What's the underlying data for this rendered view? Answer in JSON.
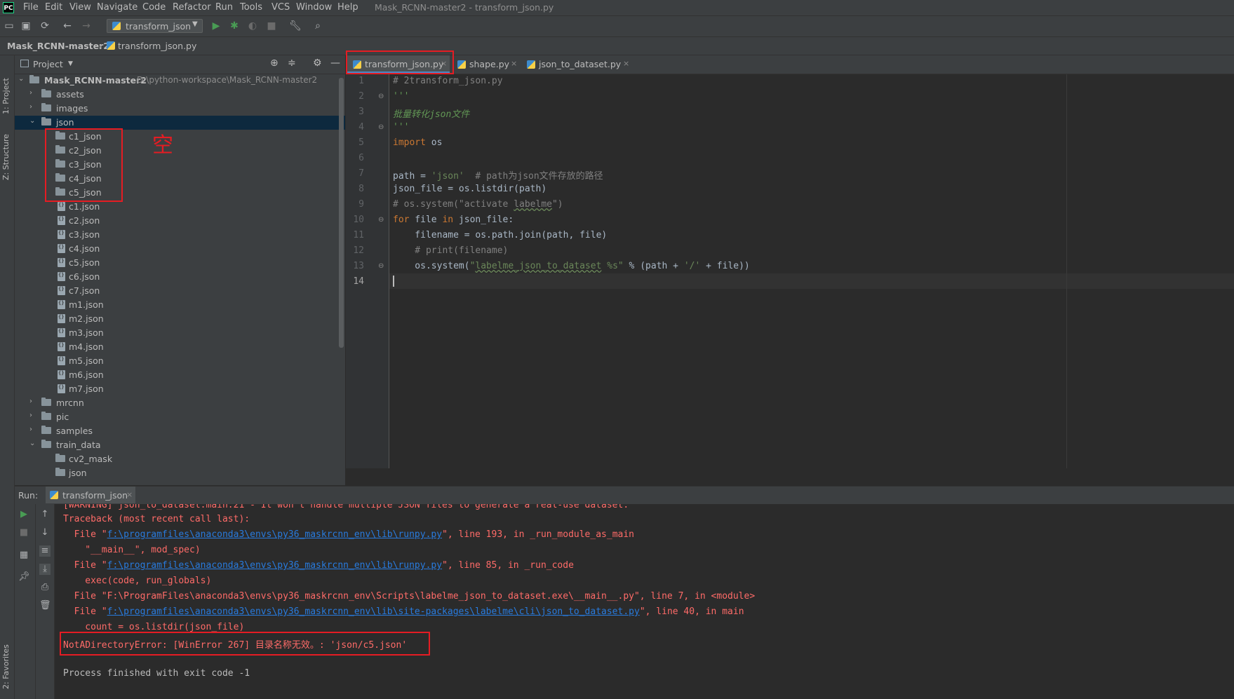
{
  "app": {
    "logo": "PC",
    "window_title": "Mask_RCNN-master2 - transform_json.py"
  },
  "menu": [
    "File",
    "Edit",
    "View",
    "Navigate",
    "Code",
    "Refactor",
    "Run",
    "Tools",
    "VCS",
    "Window",
    "Help"
  ],
  "toolbar": {
    "run_config": "transform_json",
    "icons": [
      "open-folder-icon",
      "save-icon",
      "sync-icon",
      "back-arrow-icon",
      "forward-arrow-icon",
      "run-icon",
      "debug-icon",
      "coverage-icon",
      "stop-icon",
      "wrench-icon",
      "search-icon"
    ]
  },
  "breadcrumb": [
    "Mask_RCNN-master2",
    "transform_json.py"
  ],
  "left_stripe": {
    "project": "1: Project",
    "structure": "Z: Structure",
    "favorites": "2: Favorites"
  },
  "project_panel": {
    "title": "Project",
    "root": {
      "name": "Mask_RCNN-master2",
      "path": "D:\\python-workspace\\Mask_RCNN-master2"
    },
    "tree": [
      {
        "label": "assets",
        "type": "folder",
        "expanded": false
      },
      {
        "label": "images",
        "type": "folder",
        "expanded": false
      },
      {
        "label": "json",
        "type": "folder",
        "expanded": true,
        "selected": true
      },
      {
        "label": "c1_json",
        "type": "folder"
      },
      {
        "label": "c2_json",
        "type": "folder"
      },
      {
        "label": "c3_json",
        "type": "folder"
      },
      {
        "label": "c4_json",
        "type": "folder"
      },
      {
        "label": "c5_json",
        "type": "folder"
      },
      {
        "label": "c1.json",
        "type": "file"
      },
      {
        "label": "c2.json",
        "type": "file"
      },
      {
        "label": "c3.json",
        "type": "file"
      },
      {
        "label": "c4.json",
        "type": "file"
      },
      {
        "label": "c5.json",
        "type": "file"
      },
      {
        "label": "c6.json",
        "type": "file"
      },
      {
        "label": "c7.json",
        "type": "file"
      },
      {
        "label": "m1.json",
        "type": "file"
      },
      {
        "label": "m2.json",
        "type": "file"
      },
      {
        "label": "m3.json",
        "type": "file"
      },
      {
        "label": "m4.json",
        "type": "file"
      },
      {
        "label": "m5.json",
        "type": "file"
      },
      {
        "label": "m6.json",
        "type": "file"
      },
      {
        "label": "m7.json",
        "type": "file"
      },
      {
        "label": "mrcnn",
        "type": "folder",
        "expanded": false
      },
      {
        "label": "pic",
        "type": "folder",
        "expanded": false
      },
      {
        "label": "samples",
        "type": "folder",
        "expanded": false
      },
      {
        "label": "train_data",
        "type": "folder",
        "expanded": true
      },
      {
        "label": "cv2_mask",
        "type": "folder"
      },
      {
        "label": "json",
        "type": "folder"
      }
    ],
    "annotation": "空"
  },
  "editor": {
    "tabs": [
      {
        "label": "transform_json.py",
        "active": true
      },
      {
        "label": "shape.py",
        "active": false
      },
      {
        "label": "json_to_dataset.py",
        "active": false
      }
    ],
    "line_numbers": [
      "1",
      "2",
      "3",
      "4",
      "5",
      "6",
      "7",
      "8",
      "9",
      "10",
      "11",
      "12",
      "13",
      "14"
    ],
    "code": {
      "l1": "# 2transform_json.py",
      "l2": "'''",
      "l3": "批量转化json文件",
      "l4": "'''",
      "l5_kw": "import",
      "l5_rest": " os",
      "l7_a": "path = ",
      "l7_str": "'json'",
      "l7_cm": "  # path为json文件存放的路径",
      "l8": "json_file = os.listdir(path)",
      "l9_a": "# os.system(\"activate ",
      "l9_b": "labelme",
      "l9_c": "\")",
      "l10_kw1": "for",
      "l10_b": " file ",
      "l10_kw2": "in",
      "l10_c": " json_file:",
      "l11": "    filename = os.path.join(path, file)",
      "l12": "    # print(filename)",
      "l13_a": "    os.system(",
      "l13_str1": "\"",
      "l13_str2": "labelme_json_to_dataset",
      "l13_str3": " %s\"",
      "l13_b": " % (path + ",
      "l13_str4": "'/'",
      "l13_c": " + file))"
    }
  },
  "run_panel": {
    "label": "Run:",
    "tab": "transform_json",
    "console": {
      "c0": "[WARNING] json_to_dataset:main:21 - It won't handle multiple JSON files to generate a real-use dataset.",
      "c1": "Traceback (most recent call last):",
      "c2_a": "  File \"",
      "c2_link": "f:\\programfiles\\anaconda3\\envs\\py36_maskrcnn_env\\lib\\runpy.py",
      "c2_b": "\", line 193, in _run_module_as_main",
      "c3": "    \"__main__\", mod_spec)",
      "c4_a": "  File \"",
      "c4_link": "f:\\programfiles\\anaconda3\\envs\\py36_maskrcnn_env\\lib\\runpy.py",
      "c4_b": "\", line 85, in _run_code",
      "c5": "    exec(code, run_globals)",
      "c6": "  File \"F:\\ProgramFiles\\anaconda3\\envs\\py36_maskrcnn_env\\Scripts\\labelme_json_to_dataset.exe\\__main__.py\", line 7, in <module>",
      "c7_a": "  File \"",
      "c7_link": "f:\\programfiles\\anaconda3\\envs\\py36_maskrcnn_env\\lib\\site-packages\\labelme\\cli\\json_to_dataset.py",
      "c7_b": "\", line 40, in main",
      "c8": "    count = os.listdir(json_file)",
      "c9": "NotADirectoryError: [WinError 267] 目录名称无效。: 'json/c5.json'",
      "c10": "Process finished with exit code -1"
    }
  },
  "colors": {
    "background": "#2b2b2b",
    "panel": "#3c3f41",
    "keyword": "#cc7832",
    "string": "#6a8759",
    "comment": "#808080",
    "error": "#ff6b68",
    "link": "#287bde",
    "annotation_red": "#e51c23"
  }
}
